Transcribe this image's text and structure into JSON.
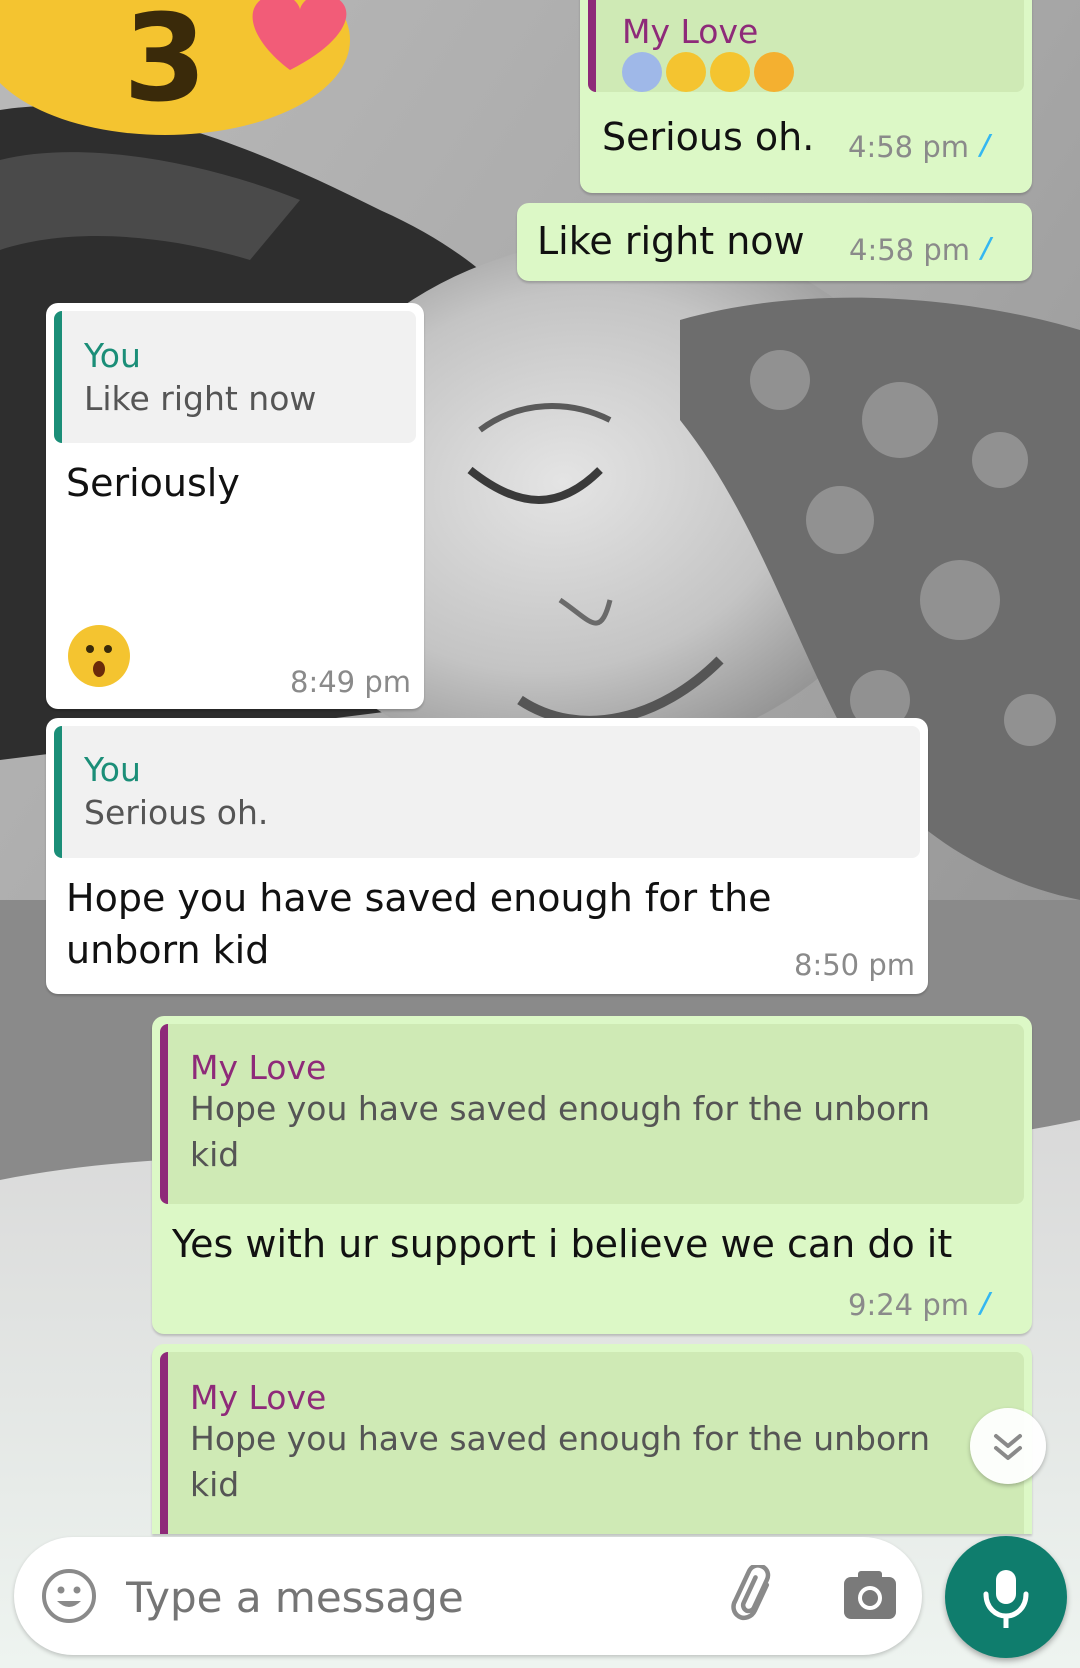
{
  "colors": {
    "outgoing_bubble": "#dcf8c6",
    "incoming_bubble": "#ffffff",
    "my_love_name": "#8e2a79",
    "you_name": "#1b8e78",
    "read_ticks": "#34b7f1",
    "mic_button": "#0f7d6d"
  },
  "wallpaper": {
    "sticker_text": "3"
  },
  "messages": [
    {
      "direction": "outgoing",
      "quote": {
        "author": "My Love",
        "emoji": [
          "face-screaming-in-fear",
          "face-blowing-kiss",
          "pleading-face",
          "flushed-face"
        ]
      },
      "text": "Serious oh.",
      "time": "4:58 pm",
      "ticks": "//"
    },
    {
      "direction": "outgoing",
      "text": "Like right now",
      "time": "4:58 pm",
      "ticks": "//"
    },
    {
      "direction": "incoming",
      "quote": {
        "author": "You",
        "text": "Like right now"
      },
      "text": "Seriously",
      "emoji": "astonished-face",
      "time": "8:49 pm"
    },
    {
      "direction": "incoming",
      "quote": {
        "author": "You",
        "text": "Serious oh."
      },
      "text": "Hope you have saved enough for the\nunborn kid",
      "time": "8:50 pm"
    },
    {
      "direction": "outgoing",
      "quote": {
        "author": "My Love",
        "text": "Hope you have saved enough for the unborn\nkid"
      },
      "text": "Yes with ur support i believe we can do it",
      "time": "9:24 pm",
      "ticks": "//"
    },
    {
      "direction": "outgoing",
      "quote": {
        "author": "My Love",
        "text": "Hope you have saved enough for the unborn\nkid"
      }
    }
  ],
  "composer": {
    "placeholder": "Type a message",
    "emoji_icon": "smiley-icon",
    "attach_icon": "paperclip-icon",
    "camera_icon": "camera-icon",
    "mic_icon": "microphone-icon"
  },
  "scroll_button": {
    "icon": "double-chevron-down-icon"
  }
}
